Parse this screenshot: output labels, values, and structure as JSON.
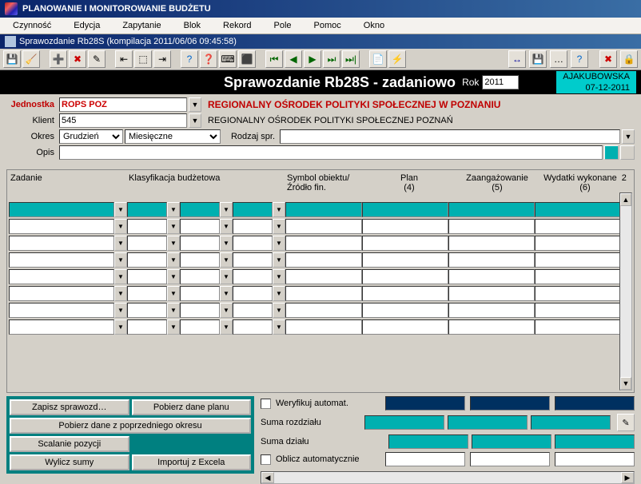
{
  "window": {
    "title": "PLANOWANIE I MONITOROWANIE BUDŻETU"
  },
  "menu": {
    "items": [
      "Czynność",
      "Edycja",
      "Zapytanie",
      "Blok",
      "Rekord",
      "Pole",
      "Pomoc",
      "Okno"
    ]
  },
  "subwindow": {
    "title": "Sprawozdanie Rb28S (kompilacja 2011/06/06 09:45:58)"
  },
  "toolbar_icons": [
    "💾",
    "🧹",
    "➕",
    "✖",
    "✎",
    "⇤",
    "⬚",
    "⇥",
    "?",
    "❓",
    "⌨",
    "⬛",
    "⏮",
    "◀",
    "▶",
    "⏭",
    "⏭|",
    "📄",
    "⚡"
  ],
  "toolbar_icons_right": [
    "↔",
    "💾",
    "…",
    "?",
    "✖",
    "🔒"
  ],
  "header": {
    "title": "Sprawozdanie Rb28S - zadaniowo",
    "rok_label": "Rok",
    "rok_value": "2011",
    "user": "AJAKUBOWSKA",
    "date": "07-12-2011"
  },
  "form": {
    "jednostka_label": "Jednostka",
    "jednostka_value": "ROPS POZ",
    "jednostka_desc": "REGIONALNY OŚRODEK POLITYKI SPOŁECZNEJ W POZNANIU",
    "klient_label": "Klient",
    "klient_value": "545",
    "klient_desc": "REGIONALNY OŚRODEK POLITYKI SPOŁECZNEJ POZNAŃ",
    "okres_label": "Okres",
    "okres_value": "Grudzień",
    "okres_type": "Miesięczne",
    "rodzaj_label": "Rodzaj spr.",
    "rodzaj_value": "",
    "opis_label": "Opis",
    "opis_value": ""
  },
  "grid": {
    "col_zadanie": "Zadanie",
    "col_klasyf": "Klasyfikacja budżetowa",
    "col_symbol": "Symbol obiektu/Źródło fin.",
    "col_plan": "Plan\n(4)",
    "col_zaang": "Zaangażowanie\n(5)",
    "col_wydatki": "Wydatki wykonane  2\n(6)"
  },
  "bottom": {
    "btn_zapisz": "Zapisz sprawozd…",
    "btn_pobierz_plan": "Pobierz dane planu",
    "btn_pobierz_poprz": "Pobierz dane z poprzedniego okresu",
    "btn_scalanie": "Scalanie pozycji",
    "btn_wylicz": "Wylicz sumy",
    "btn_import": "Importuj z Excela",
    "chk_weryfikuj": "Weryfikuj automat.",
    "lbl_suma_rozdz": "Suma rozdziału",
    "lbl_suma_dzialu": "Suma działu",
    "chk_oblicz": "Oblicz automatycznie"
  }
}
